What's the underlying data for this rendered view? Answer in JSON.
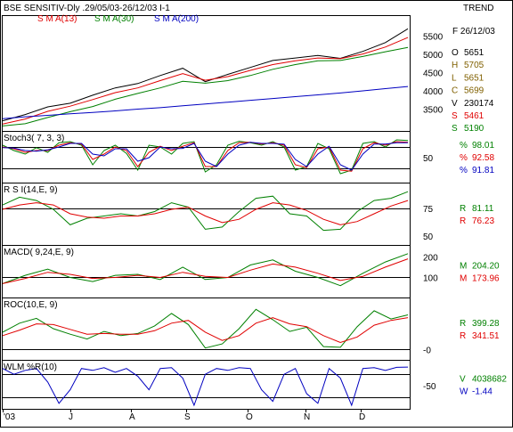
{
  "header": {
    "title": "BSE SENSITIV-Dly .29/05/03-26/12/03  I-1",
    "sma_labels": [
      {
        "text": "S M A(13)",
        "color": "#e00000"
      },
      {
        "text": "S M A(30)",
        "color": "#008000"
      },
      {
        "text": "S M A(200)",
        "color": "#0000c0"
      }
    ],
    "trend": "TREND"
  },
  "x_axis": {
    "labels": [
      "'03",
      "J",
      "J",
      "A",
      "S",
      "O",
      "N",
      "D"
    ]
  },
  "colors": {
    "price": "#000000",
    "red": "#e00000",
    "green": "#008000",
    "blue": "#0000c0",
    "frame": "#000000",
    "refline": "#000000"
  },
  "side_info": {
    "date": "F 26/12/03",
    "ohlc": [
      {
        "key": "O",
        "value": "5651",
        "color": "#000000"
      },
      {
        "key": "H",
        "value": "5705",
        "color": "#806000"
      },
      {
        "key": "L",
        "value": "5651",
        "color": "#806000"
      },
      {
        "key": "C",
        "value": "5699",
        "color": "#806000"
      },
      {
        "key": "V",
        "value": "230174",
        "color": "#000000"
      },
      {
        "key": "S",
        "value": "5461",
        "color": "#e00000"
      },
      {
        "key": "S",
        "value": "5190",
        "color": "#008000"
      }
    ]
  },
  "chart_data": [
    {
      "type": "line",
      "title": "BSE SENSITIV-Dly .29/05/03-26/12/03",
      "ylim": [
        3000,
        5950
      ],
      "yticks": [
        "5500",
        "5000",
        "4500",
        "4000",
        "3500"
      ],
      "ytick_values": [
        5500,
        5000,
        4500,
        4000,
        3500
      ],
      "series": [
        {
          "name": "Price",
          "color": "#000000",
          "x": [
            0,
            8,
            16,
            24,
            32,
            40,
            48,
            56,
            64,
            72,
            80,
            88,
            96,
            104,
            112,
            120,
            128,
            136,
            144
          ],
          "values": [
            3180,
            3350,
            3560,
            3660,
            3880,
            4080,
            4200,
            4420,
            4620,
            4250,
            4450,
            4640,
            4830,
            4900,
            4970,
            4890,
            5080,
            5320,
            5699
          ]
        },
        {
          "name": "S M A(13)",
          "color": "#e00000",
          "x": [
            0,
            8,
            16,
            24,
            32,
            40,
            48,
            56,
            64,
            72,
            80,
            88,
            96,
            104,
            112,
            120,
            128,
            136,
            144
          ],
          "values": [
            3090,
            3230,
            3440,
            3580,
            3760,
            3950,
            4080,
            4280,
            4470,
            4290,
            4390,
            4560,
            4720,
            4820,
            4900,
            4880,
            5010,
            5200,
            5461
          ]
        },
        {
          "name": "S M A(30)",
          "color": "#008000",
          "x": [
            0,
            8,
            16,
            24,
            32,
            40,
            48,
            56,
            64,
            72,
            80,
            88,
            96,
            104,
            112,
            120,
            128,
            136,
            144
          ],
          "values": [
            3040,
            3100,
            3270,
            3430,
            3570,
            3770,
            3930,
            4080,
            4260,
            4210,
            4280,
            4420,
            4590,
            4720,
            4820,
            4830,
            4940,
            5070,
            5190
          ]
        },
        {
          "name": "S M A(200)",
          "color": "#0000c0",
          "x": [
            0,
            8,
            16,
            24,
            32,
            40,
            48,
            56,
            64,
            72,
            80,
            88,
            96,
            104,
            112,
            120,
            128,
            136,
            144
          ],
          "values": [
            3240,
            3290,
            3330,
            3370,
            3410,
            3450,
            3500,
            3540,
            3590,
            3640,
            3690,
            3740,
            3790,
            3840,
            3890,
            3940,
            4000,
            4060,
            4120
          ]
        }
      ],
      "readouts": []
    },
    {
      "type": "line",
      "title": "Stoch3( 7, 3, 3)",
      "ylim": [
        -10,
        115
      ],
      "yticks": [
        "50"
      ],
      "ytick_values": [
        50
      ],
      "ref_lines": [
        20,
        80
      ],
      "series": [
        {
          "name": "%K",
          "color": "#008000",
          "x": [
            0,
            4,
            8,
            12,
            16,
            20,
            24,
            28,
            32,
            36,
            40,
            44,
            48,
            52,
            56,
            60,
            64,
            68,
            72,
            76,
            80,
            84,
            88,
            92,
            96,
            100,
            104,
            108,
            112,
            116,
            120,
            124,
            128,
            132,
            136,
            140,
            144
          ],
          "values": [
            85,
            70,
            60,
            78,
            65,
            92,
            95,
            85,
            30,
            70,
            85,
            62,
            15,
            85,
            80,
            60,
            90,
            95,
            10,
            30,
            85,
            96,
            92,
            85,
            95,
            80,
            15,
            25,
            90,
            75,
            5,
            15,
            90,
            95,
            80,
            100,
            98
          ]
        },
        {
          "name": "%D",
          "color": "#e00000",
          "x": [
            0,
            4,
            8,
            12,
            16,
            20,
            24,
            28,
            32,
            36,
            40,
            44,
            48,
            52,
            56,
            60,
            64,
            68,
            72,
            76,
            80,
            84,
            88,
            92,
            96,
            100,
            104,
            108,
            112,
            116,
            120,
            124,
            128,
            132,
            136,
            140,
            144
          ],
          "values": [
            80,
            75,
            65,
            70,
            70,
            85,
            92,
            88,
            45,
            60,
            80,
            70,
            25,
            65,
            82,
            70,
            82,
            92,
            25,
            25,
            70,
            92,
            93,
            88,
            92,
            85,
            30,
            22,
            75,
            80,
            15,
            12,
            75,
            92,
            85,
            95,
            93
          ]
        },
        {
          "name": "%",
          "color": "#0000c0",
          "x": [
            0,
            4,
            8,
            12,
            16,
            20,
            24,
            28,
            32,
            36,
            40,
            44,
            48,
            52,
            56,
            60,
            64,
            68,
            72,
            76,
            80,
            84,
            88,
            92,
            96,
            100,
            104,
            108,
            112,
            116,
            120,
            124,
            128,
            132,
            136,
            140,
            144
          ],
          "values": [
            78,
            77,
            70,
            68,
            72,
            80,
            90,
            90,
            60,
            55,
            75,
            75,
            40,
            50,
            80,
            75,
            76,
            90,
            40,
            25,
            60,
            85,
            93,
            90,
            90,
            88,
            45,
            25,
            60,
            82,
            30,
            15,
            60,
            88,
            88,
            92,
            92
          ]
        }
      ],
      "readouts": [
        {
          "key": "%",
          "value": "98.01",
          "color": "#008000"
        },
        {
          "key": "%",
          "value": "92.58",
          "color": "#e00000"
        },
        {
          "key": "%",
          "value": "91.81",
          "color": "#0000c0"
        }
      ]
    },
    {
      "type": "line",
      "title": "R S I(14,E, 9)",
      "ylim": [
        45,
        95
      ],
      "yticks": [
        "75",
        "50"
      ],
      "ytick_values": [
        75,
        50
      ],
      "ref_lines": [
        75
      ],
      "series": [
        {
          "name": "RSI",
          "color": "#008000",
          "x": [
            0,
            6,
            12,
            18,
            24,
            30,
            36,
            42,
            48,
            54,
            60,
            66,
            72,
            78,
            84,
            90,
            96,
            102,
            108,
            114,
            120,
            126,
            132,
            138,
            144
          ],
          "values": [
            78,
            85,
            82,
            74,
            60,
            66,
            68,
            70,
            68,
            72,
            80,
            76,
            56,
            58,
            72,
            84,
            86,
            70,
            68,
            55,
            56,
            72,
            82,
            84,
            90
          ]
        },
        {
          "name": "Signal",
          "color": "#e00000",
          "x": [
            0,
            6,
            12,
            18,
            24,
            30,
            36,
            42,
            48,
            54,
            60,
            66,
            72,
            78,
            84,
            90,
            96,
            102,
            108,
            114,
            120,
            126,
            132,
            138,
            144
          ],
          "values": [
            74,
            78,
            80,
            78,
            70,
            67,
            66,
            68,
            68,
            70,
            74,
            76,
            68,
            62,
            65,
            74,
            80,
            78,
            73,
            65,
            60,
            63,
            70,
            77,
            82
          ]
        }
      ],
      "readouts": [
        {
          "key": "R",
          "value": "81.11",
          "color": "#008000"
        },
        {
          "key": "R",
          "value": "76.23",
          "color": "#e00000"
        }
      ]
    },
    {
      "type": "line",
      "title": "MACD( 9,24,E, 9)",
      "ylim": [
        20,
        240
      ],
      "yticks": [
        "200",
        "100"
      ],
      "ytick_values": [
        200,
        100
      ],
      "ref_lines": [
        100
      ],
      "series": [
        {
          "name": "MACD",
          "color": "#008000",
          "x": [
            0,
            8,
            16,
            24,
            32,
            40,
            48,
            56,
            64,
            72,
            80,
            88,
            96,
            104,
            112,
            120,
            128,
            136,
            144
          ],
          "values": [
            70,
            110,
            140,
            100,
            80,
            110,
            115,
            90,
            150,
            90,
            100,
            160,
            185,
            130,
            100,
            60,
            120,
            175,
            215
          ]
        },
        {
          "name": "Signal",
          "color": "#e00000",
          "x": [
            0,
            8,
            16,
            24,
            32,
            40,
            48,
            56,
            64,
            72,
            80,
            88,
            96,
            104,
            112,
            120,
            128,
            136,
            144
          ],
          "values": [
            70,
            95,
            125,
            115,
            95,
            100,
            110,
            100,
            125,
            105,
            100,
            135,
            165,
            150,
            120,
            85,
            105,
            150,
            190
          ]
        }
      ],
      "readouts": [
        {
          "key": "M",
          "value": "204.20",
          "color": "#008000"
        },
        {
          "key": "M",
          "value": "173.96",
          "color": "#e00000"
        }
      ]
    },
    {
      "type": "line",
      "title": "ROC(10,E, 9)",
      "ylim": [
        -100,
        700
      ],
      "yticks": [
        "-0"
      ],
      "ytick_values": [
        0
      ],
      "ref_lines": [
        0
      ],
      "series": [
        {
          "name": "ROC",
          "color": "#008000",
          "x": [
            0,
            6,
            12,
            18,
            24,
            30,
            36,
            42,
            48,
            54,
            60,
            66,
            72,
            78,
            84,
            90,
            96,
            102,
            108,
            114,
            120,
            126,
            132,
            138,
            144
          ],
          "values": [
            250,
            380,
            450,
            300,
            220,
            150,
            260,
            200,
            230,
            340,
            520,
            360,
            20,
            80,
            300,
            580,
            430,
            260,
            320,
            40,
            30,
            330,
            560,
            440,
            500
          ]
        },
        {
          "name": "Signal",
          "color": "#e00000",
          "x": [
            0,
            6,
            12,
            18,
            24,
            30,
            36,
            42,
            48,
            54,
            60,
            66,
            72,
            78,
            84,
            90,
            96,
            102,
            108,
            114,
            120,
            126,
            132,
            138,
            144
          ],
          "values": [
            200,
            280,
            370,
            360,
            290,
            220,
            230,
            220,
            220,
            270,
            380,
            420,
            250,
            130,
            200,
            380,
            460,
            370,
            330,
            200,
            100,
            180,
            350,
            420,
            460
          ]
        }
      ],
      "readouts": [
        {
          "key": "R",
          "value": "399.28",
          "color": "#008000"
        },
        {
          "key": "R",
          "value": "341.51",
          "color": "#e00000"
        }
      ]
    },
    {
      "type": "line",
      "title": "WLM %R(10)",
      "ylim": [
        -100,
        8
      ],
      "yticks": [
        "-50"
      ],
      "ytick_values": [
        -50
      ],
      "ref_lines": [
        -20,
        -80
      ],
      "series": [
        {
          "name": "WLM %R",
          "color": "#0000c0",
          "x": [
            0,
            4,
            8,
            12,
            16,
            20,
            24,
            28,
            32,
            36,
            40,
            44,
            48,
            52,
            56,
            60,
            64,
            68,
            72,
            76,
            80,
            84,
            88,
            92,
            96,
            100,
            104,
            108,
            112,
            116,
            120,
            124,
            128,
            132,
            136,
            140,
            144
          ],
          "values": [
            -5,
            -20,
            -10,
            -5,
            -40,
            -95,
            -60,
            -5,
            -10,
            -3,
            -15,
            -5,
            -25,
            -60,
            -5,
            -3,
            -30,
            -100,
            -20,
            -5,
            -10,
            -3,
            -5,
            -60,
            -90,
            -20,
            -5,
            -70,
            -95,
            -5,
            -30,
            -100,
            -5,
            -3,
            -10,
            -2,
            -1.44
          ]
        }
      ],
      "readouts": [
        {
          "key": "V",
          "value": "4038682",
          "color": "#008000"
        },
        {
          "key": "W",
          "value": "-1.44",
          "color": "#0000c0"
        }
      ]
    }
  ]
}
